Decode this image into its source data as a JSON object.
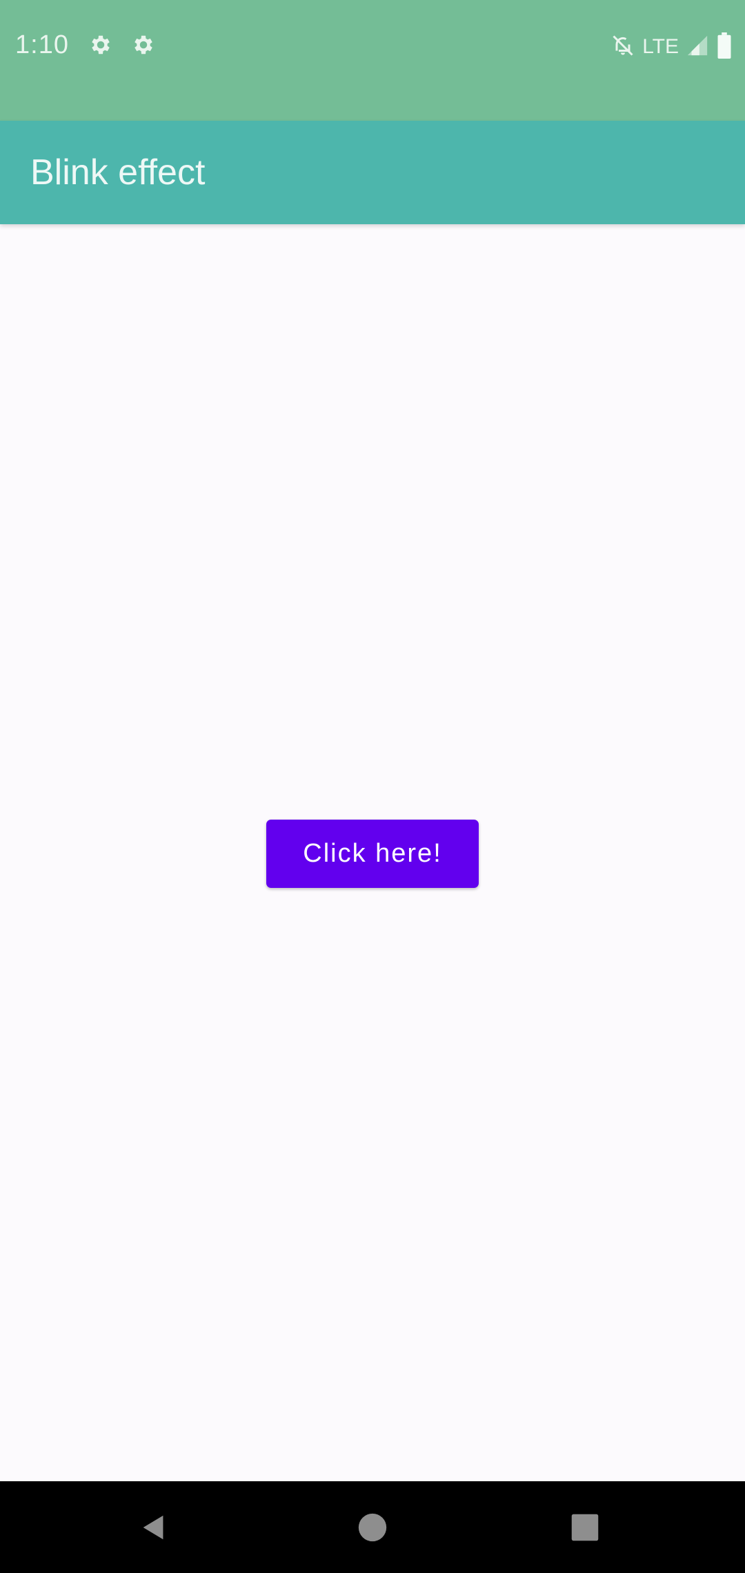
{
  "status_bar": {
    "time": "1:10",
    "network": "LTE",
    "icons": [
      "settings-icon",
      "settings-icon",
      "notifications-off-icon",
      "signal-icon",
      "battery-icon"
    ]
  },
  "app_bar": {
    "title": "Blink effect"
  },
  "main": {
    "button_label": "Click here!"
  },
  "nav_bar": {
    "icons": [
      "back-icon",
      "home-icon",
      "recents-icon"
    ]
  },
  "colors": {
    "status_bar": "#74BD96",
    "app_bar": "#4DB6AC",
    "button": "#6200EE",
    "background": "#FCFAFD",
    "nav_bar": "#000000"
  }
}
